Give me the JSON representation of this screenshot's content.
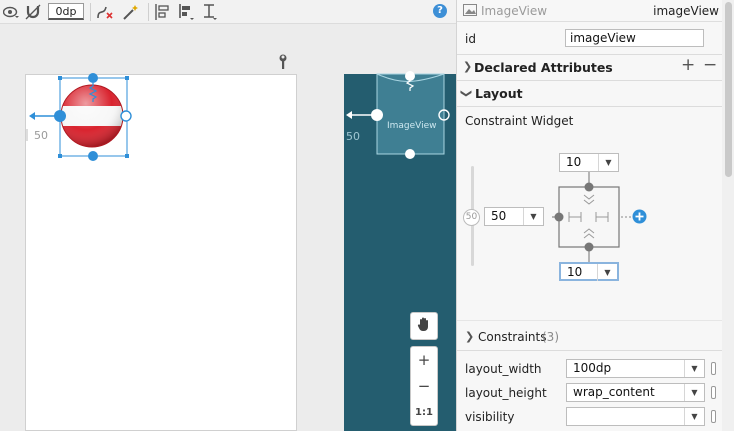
{
  "toolbar": {
    "default_margin": "0dp",
    "help": "?"
  },
  "icons": {
    "eye": "eye-icon",
    "magnet": "magnet-icon",
    "clear_constraints": "clear-constraints-icon",
    "infer_constraints": "magic-wand-icon",
    "pack": "pack-icon",
    "align": "align-icon",
    "guidelines": "guidelines-icon",
    "wrench": "wrench-icon",
    "pan": "hand-icon"
  },
  "canvas": {
    "design_margin": "50",
    "blueprint_margin": "50",
    "blueprint_view_label": "ImageView"
  },
  "zoom": {
    "zoom_in": "+",
    "zoom_out": "−",
    "actual_size": "1:1"
  },
  "attributes": {
    "widget_type": "ImageView",
    "widget_id": "imageView",
    "id_label": "id",
    "id_value": "imageView",
    "declared_attributes": "Declared Attributes",
    "add": "+",
    "remove": "−",
    "layout_section": "Layout",
    "constraint_widget": "Constraint Widget",
    "bias": "50",
    "margin_top": "10",
    "margin_start": "50",
    "margin_bottom": "10",
    "constraints_label": "Constraints",
    "constraints_count": "(3)",
    "layout_width_label": "layout_width",
    "layout_width_value": "100dp",
    "layout_height_label": "layout_height",
    "layout_height_value": "wrap_content",
    "visibility_label": "visibility",
    "visibility_value": ""
  },
  "colors": {
    "accent": "#2f8fd8",
    "blueprint": "#245d6f",
    "flag_red": "#d9232e"
  }
}
